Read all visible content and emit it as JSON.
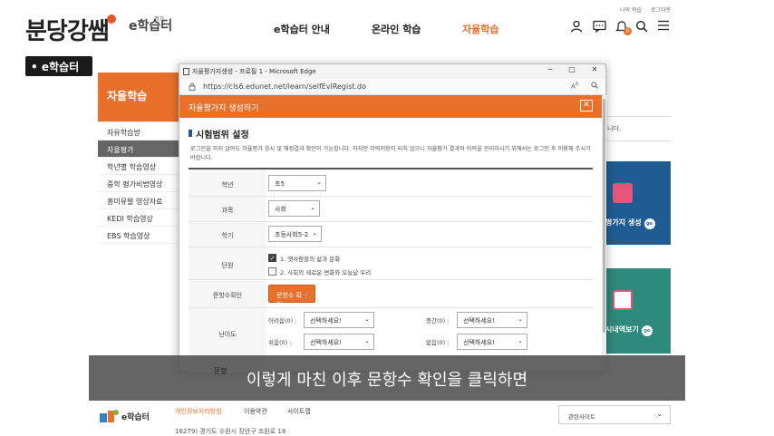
{
  "header": {
    "brand": "분당강쌤",
    "brand_sub": "e학습터",
    "brand_region": "경기",
    "badge": "• e학습터",
    "nav": [
      "e학습터 안내",
      "온라인 학습",
      "자율학습"
    ],
    "util_links": [
      "나의 학습",
      "로그아웃"
    ],
    "notification_count": "0"
  },
  "sidebar": {
    "title": "자율학습",
    "items": [
      "자유학습방",
      "자율평가",
      "학년별 학습영상",
      "중학 평가비법영상",
      "흥미유발 영상자료",
      "KEDI 학습영상",
      "EBS 학습영상"
    ],
    "active_index": 1
  },
  "right": {
    "note": "니다.",
    "tile1": "평가지 생성",
    "tile2": "시내역보기",
    "go": "go"
  },
  "popup": {
    "window_title": "자율평가지생성 - 프로필 1 - Microsoft Edge",
    "address": "https://cls6.edunet.net/learn/selfEvlRegist.do",
    "header": "자율평가지 생성하기",
    "section_title": "시험범위 설정",
    "notice": "로그인을 하지 않아도 자율평가 응시 및 채점결과 확인이 가능합니다. 하지만 이력저장이 되지 않으니 자율평가 결과와 이력을 관리하시기 위해서는 로그인 후 이용해 주시기 바랍니다.",
    "labels": {
      "grade": "학년",
      "subject": "과목",
      "term": "학기",
      "unit": "단원",
      "count": "문항수확인",
      "difficulty": "난이도",
      "extra": "문항"
    },
    "grade_value": "초5",
    "subject_value": "사회",
    "term_value": "초등사회5-2",
    "units": [
      {
        "label": "1. 옛사람들의 삶과 문화",
        "checked": true
      },
      {
        "label": "2. 사회의 새로운 변화와 오늘날 우리",
        "checked": false
      }
    ],
    "confirm_button": "문항수 확인",
    "difficulty": {
      "hard_label": "어려움(0) :",
      "mid_label": "중간(0) :",
      "easy_label": "쉬움(0) :",
      "vhard_label": "없음(0) :",
      "placeholder": "선택하세요!"
    }
  },
  "subtitle": "이렇게 마친 이후 문항수 확인을 클릭하면",
  "footer": {
    "logo_text": "e학습터",
    "links": [
      "개인정보처리방침",
      "이용약관",
      "사이트맵"
    ],
    "address": "16279) 경기도 수원시 장안구 조원로 18",
    "related": "관련사이트"
  }
}
